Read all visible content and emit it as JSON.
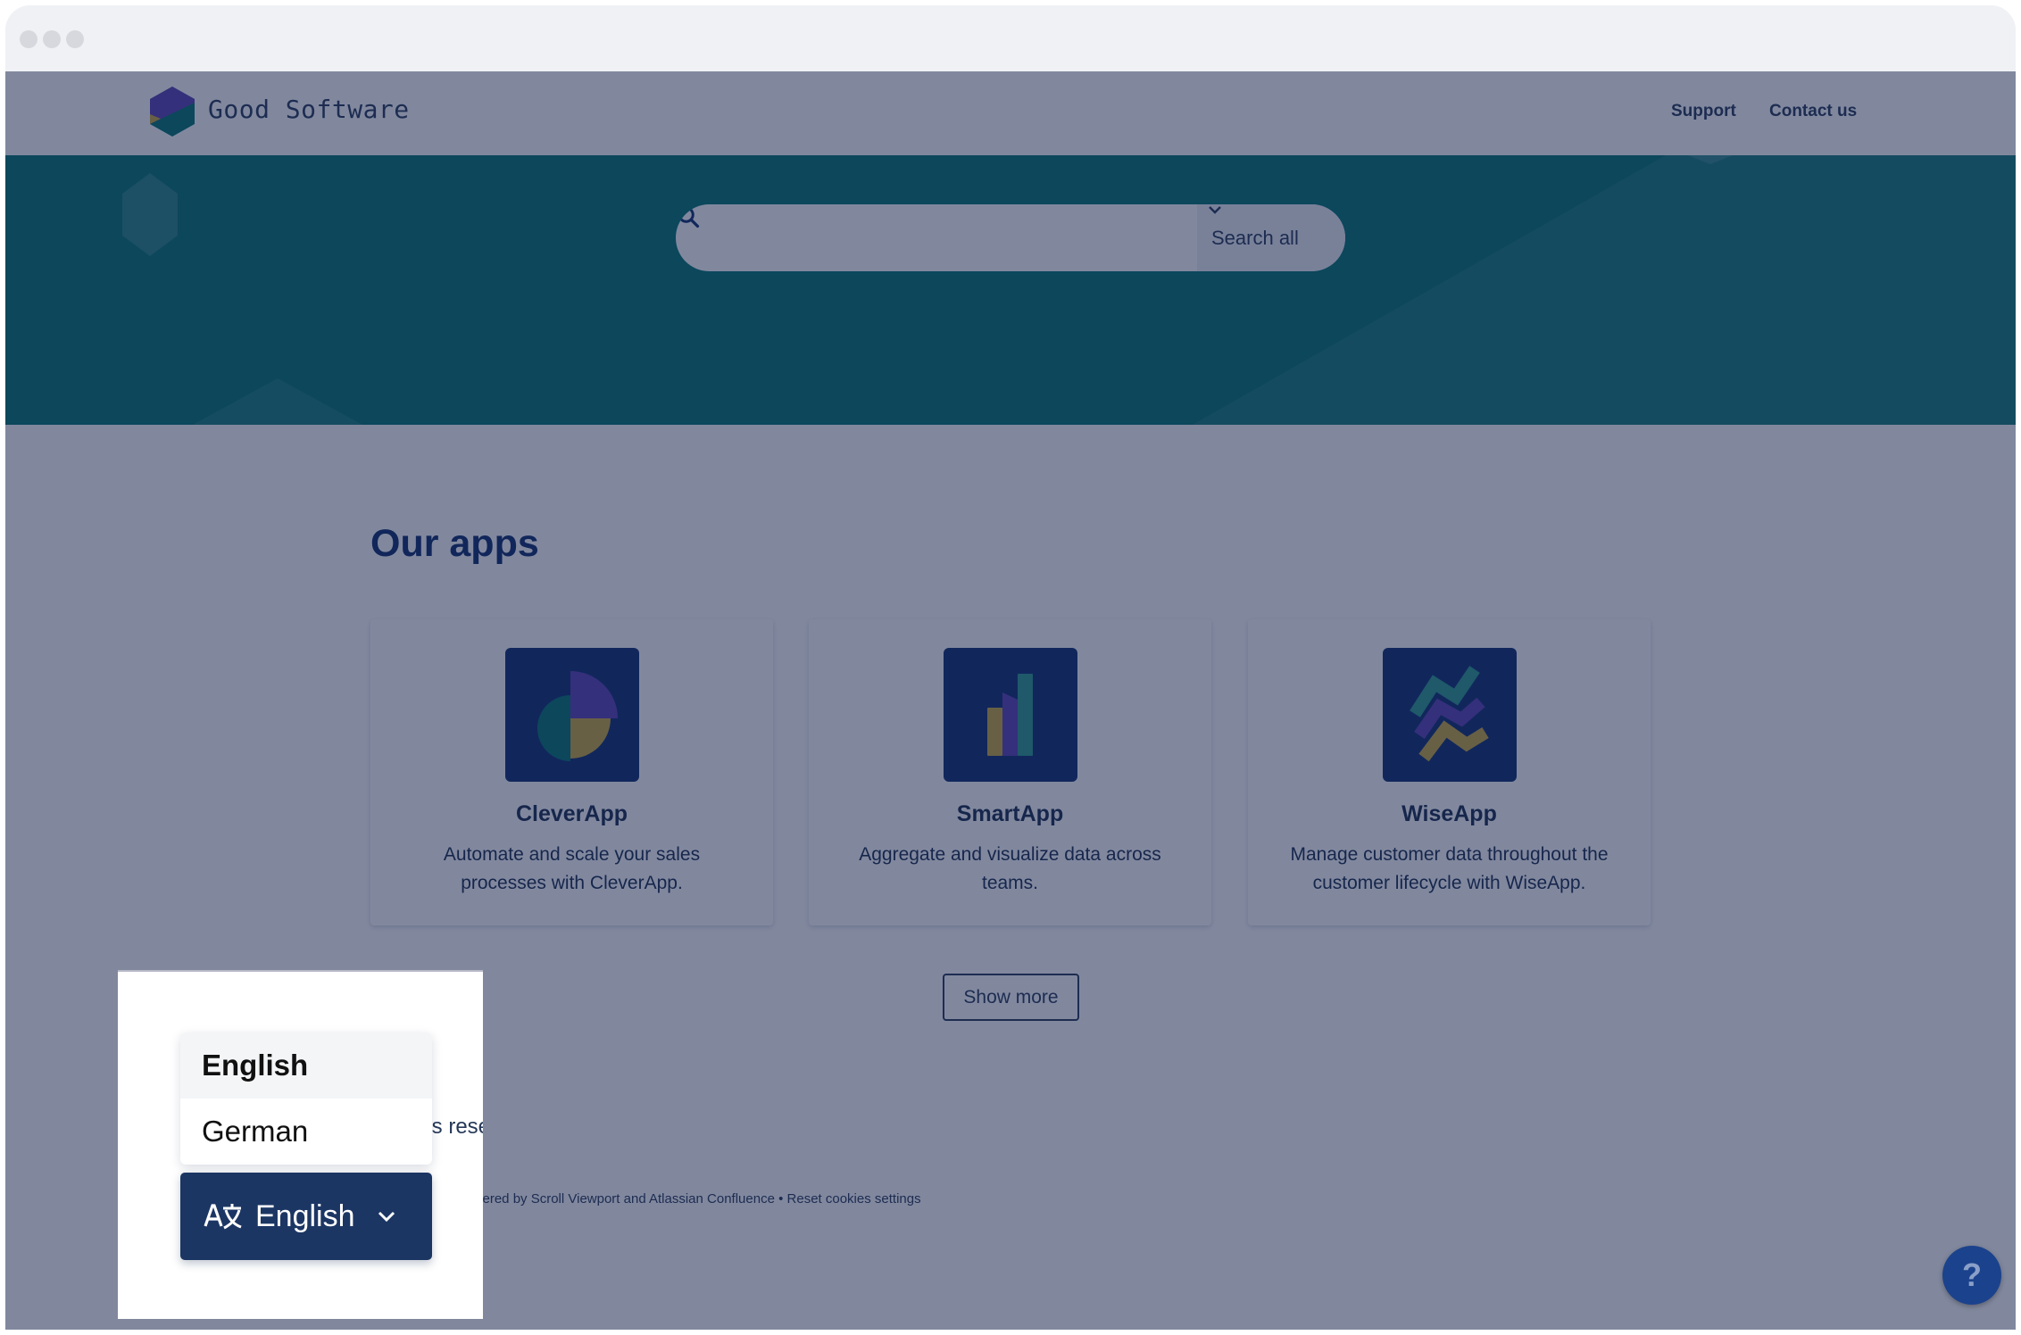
{
  "window": {
    "controls": [
      "close",
      "minimize",
      "maximize"
    ]
  },
  "header": {
    "brand": "Good Software",
    "nav": [
      {
        "label": "Support"
      },
      {
        "label": "Contact us"
      }
    ]
  },
  "search": {
    "placeholder": "",
    "value": "",
    "scope_label": "Search all"
  },
  "apps": {
    "title": "Our apps",
    "items": [
      {
        "name": "CleverApp",
        "description": "Automate and scale your sales processes with CleverApp.",
        "icon": "pie-chart-icon"
      },
      {
        "name": "SmartApp",
        "description": "Aggregate and visualize data across teams.",
        "icon": "bar-chart-icon"
      },
      {
        "name": "WiseApp",
        "description": "Manage customer data throughout the customer lifecycle with WiseApp.",
        "icon": "zigzag-lines-icon"
      }
    ],
    "show_more_label": "Show more"
  },
  "footer": {
    "copyright_partial": "ts rese",
    "powered_partial": "vered by Scroll Viewport and Atlassian Confluence",
    "separator": " • ",
    "reset_cookies": "Reset cookies settings"
  },
  "language": {
    "current": "English",
    "options": [
      {
        "label": "English",
        "selected": true
      },
      {
        "label": "German",
        "selected": false
      }
    ]
  },
  "help": {
    "label": "?"
  },
  "colors": {
    "brand_navy": "#1c3664",
    "hero_teal": "#00726f",
    "purple": "#5b3fb4",
    "gold": "#c9a83d",
    "teal": "#2b9a8f"
  }
}
